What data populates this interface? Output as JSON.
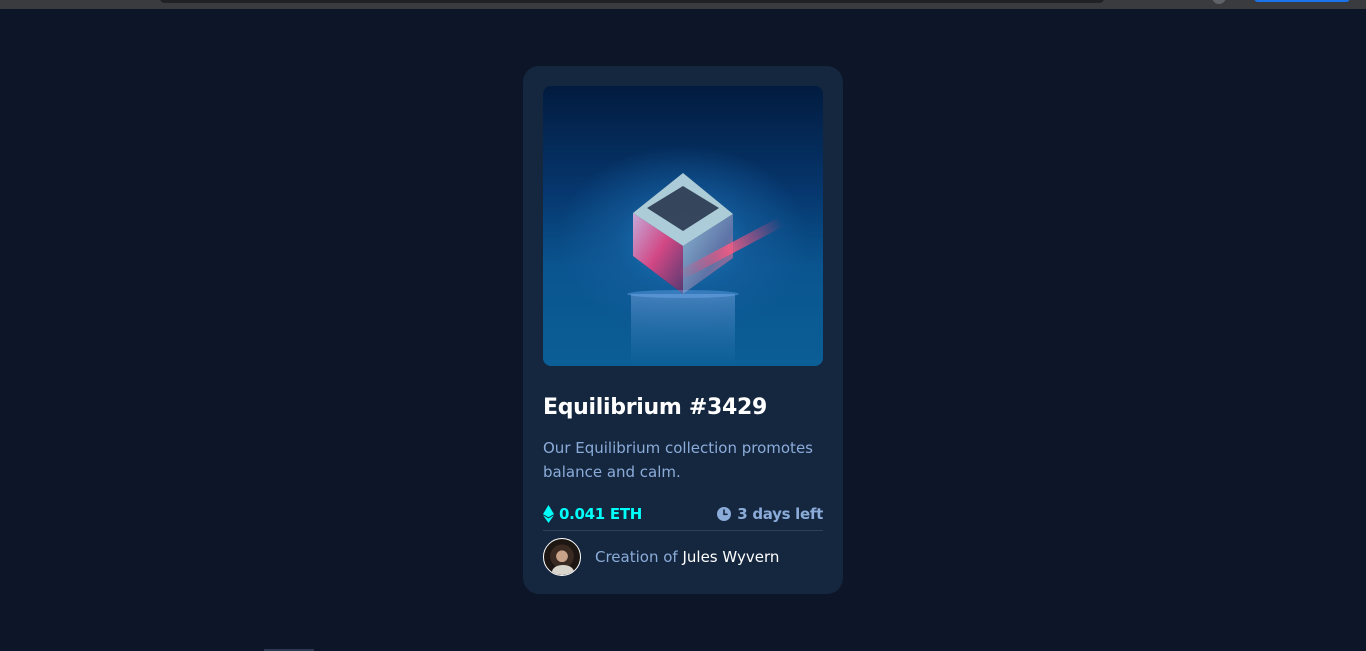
{
  "card": {
    "title": "Equilibrium #3429",
    "description": "Our Equilibrium collection promotes balance and calm.",
    "price": "0.041 ETH",
    "time_left": "3 days left",
    "creator_prefix": "Creation of",
    "creator_name": "Jules Wyvern"
  },
  "icons": {
    "price": "ethereum-icon",
    "time": "clock-icon"
  },
  "colors": {
    "page_background": "#0d1628",
    "card_background": "#15263f",
    "accent_cyan": "#00fff8",
    "soft_blue": "#8bacd9",
    "white": "#ffffff"
  }
}
